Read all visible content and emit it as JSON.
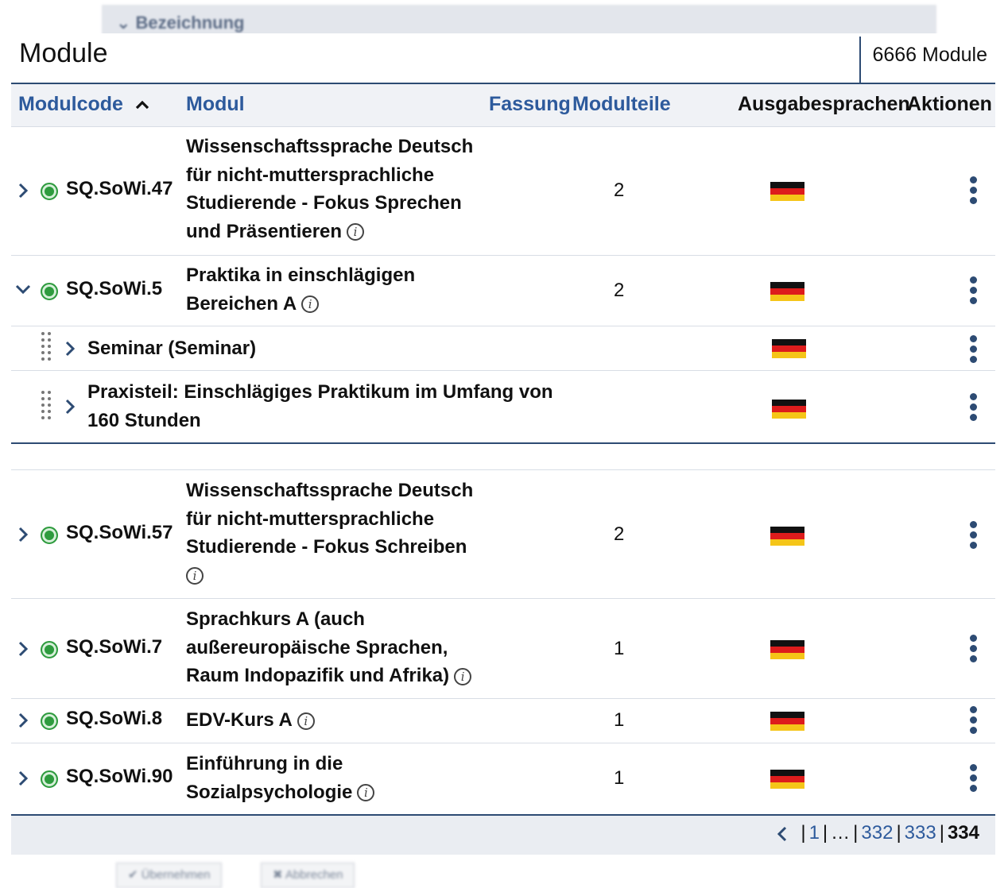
{
  "background": {
    "top_label": "Bezeichnung",
    "confirm_button": "Übernehmen",
    "cancel_button": "Abbrechen"
  },
  "panel": {
    "title": "Module",
    "count": "6666 Module"
  },
  "table": {
    "headers": {
      "modulcode": "Modulcode",
      "modul": "Modul",
      "fassung": "Fassung",
      "modulteile": "Modulteile",
      "ausgabesprachen": "Ausgabesprachen",
      "aktionen": "Aktionen"
    },
    "rows": [
      {
        "code": "SQ.SoWi.47",
        "name_lines": [
          "Wissenschaftssprache Deutsch",
          "für nicht-muttersprachliche",
          "Studierende - Fokus Sprechen",
          "und Präsentieren"
        ],
        "parts": "2",
        "language": "de-flag-icon",
        "expanded": false
      },
      {
        "code": "SQ.SoWi.5",
        "name_lines": [
          "Praktika in einschlägigen",
          "Bereichen A"
        ],
        "parts": "2",
        "language": "de-flag-icon",
        "expanded": true,
        "subitems": [
          {
            "name_lines": [
              "Seminar (Seminar)"
            ],
            "language": "de-flag-icon"
          },
          {
            "name_lines": [
              "Praxisteil: Einschlägiges Praktikum im Umfang von",
              "160 Stunden"
            ],
            "language": "de-flag-icon"
          }
        ]
      },
      {
        "code": "SQ.SoWi.57",
        "name_lines": [
          "Wissenschaftssprache Deutsch",
          "für nicht-muttersprachliche",
          "Studierende - Fokus Schreiben"
        ],
        "parts": "2",
        "language": "de-flag-icon",
        "expanded": false
      },
      {
        "code": "SQ.SoWi.7",
        "name_lines": [
          "Sprachkurs A (auch",
          "außereuropäische Sprachen,",
          "Raum Indopazifik und Afrika)"
        ],
        "parts": "1",
        "language": "de-flag-icon",
        "expanded": false
      },
      {
        "code": "SQ.SoWi.8",
        "name_lines": [
          "EDV-Kurs A"
        ],
        "parts": "1",
        "language": "de-flag-icon",
        "expanded": false
      },
      {
        "code": "SQ.SoWi.90",
        "name_lines": [
          "Einführung in die",
          "Sozialpsychologie"
        ],
        "parts": "1",
        "language": "de-flag-icon",
        "expanded": false
      }
    ]
  },
  "pagination": {
    "first": "1",
    "ellipsis": "…",
    "p1": "332",
    "p2": "333",
    "current": "334"
  },
  "colors": {
    "accent": "#2d5a9c",
    "border": "#2d4b73",
    "status_active": "#2e9b3e",
    "header_bg": "#f0f2f6"
  }
}
